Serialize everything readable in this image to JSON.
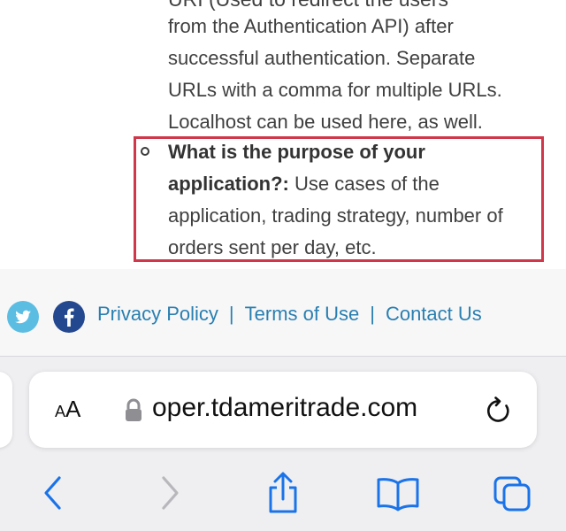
{
  "article": {
    "partial_top_line": "URI (Used to redirect the users",
    "lines": [
      "from the Authentication API) after",
      "successful authentication. Separate",
      "URLs with a comma for multiple URLs.",
      "Localhost can be used here, as well."
    ],
    "list_item": {
      "bold_line1": "What is the purpose of your",
      "bold_line2": "application?:",
      "rest_line2": " Use cases of the",
      "line3": "application, trading strategy, number of",
      "line4": "orders sent per day, etc."
    }
  },
  "footer": {
    "links": [
      "Privacy Policy",
      "Terms of Use",
      "Contact Us"
    ],
    "separator": "|"
  },
  "browser": {
    "text_size_label_small": "A",
    "text_size_label_large": "A",
    "url": "oper.tdameritrade.com"
  },
  "colors": {
    "highlight_border": "#d0374b",
    "link": "#2a7fb0",
    "safari_blue": "#1a73e8",
    "twitter": "#5cbde3",
    "facebook": "#24488f"
  },
  "icons": [
    "twitter-icon",
    "facebook-icon",
    "lock-icon",
    "reload-icon",
    "back-icon",
    "forward-icon",
    "share-icon",
    "bookmarks-icon",
    "tabs-icon"
  ]
}
